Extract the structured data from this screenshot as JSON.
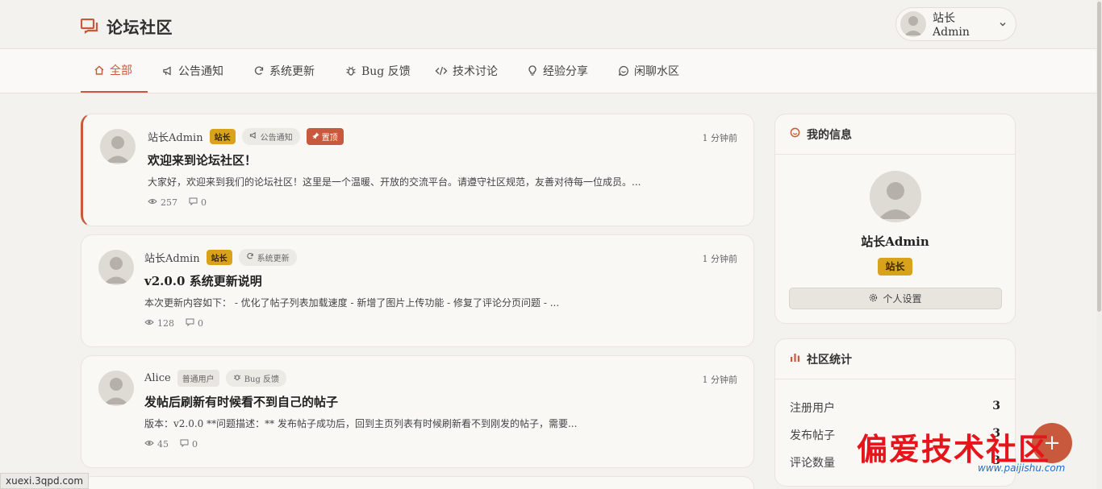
{
  "header": {
    "site_title": "论坛社区",
    "user_name": "站长Admin"
  },
  "nav": {
    "tabs": [
      {
        "label": "全部",
        "icon": "home-icon"
      },
      {
        "label": "公告通知",
        "icon": "megaphone-icon"
      },
      {
        "label": "系统更新",
        "icon": "refresh-icon"
      },
      {
        "label": "Bug 反馈",
        "icon": "bug-icon"
      },
      {
        "label": "技术讨论",
        "icon": "code-icon"
      },
      {
        "label": "经验分享",
        "icon": "lightbulb-icon"
      },
      {
        "label": "闲聊水区",
        "icon": "chat-icon"
      }
    ],
    "active": "全部"
  },
  "posts": [
    {
      "author": "站长Admin",
      "role": "站长",
      "category": "公告通知",
      "pin": "置顶",
      "time": "1 分钟前",
      "title": "欢迎来到论坛社区！",
      "excerpt": "大家好，欢迎来到我们的论坛社区！这里是一个温暖、开放的交流平台。请遵守社区规范，友善对待每一位成员。...",
      "views": "257",
      "comments": "0"
    },
    {
      "author": "站长Admin",
      "role": "站长",
      "category": "系统更新",
      "time": "1 分钟前",
      "title": "v2.0.0 系统更新说明",
      "excerpt": "本次更新内容如下： - 优化了帖子列表加载速度 - 新增了图片上传功能 - 修复了评论分页问题 - ...",
      "views": "128",
      "comments": "0"
    },
    {
      "author": "Alice",
      "role": "普通用户",
      "category": "Bug 反馈",
      "time": "1 分钟前",
      "title": "发帖后刷新有时候看不到自己的帖子",
      "excerpt": "版本：v2.0.0 **问题描述：** 发布帖子成功后，回到主页列表有时候刷新看不到刚发的帖子，需要...",
      "views": "45",
      "comments": "0"
    }
  ],
  "sidebar": {
    "my_info": {
      "title": "我的信息",
      "name": "站长Admin",
      "role": "站长",
      "settings_label": "个人设置"
    },
    "community_stats": {
      "title": "社区统计",
      "rows": [
        {
          "label": "注册用户",
          "value": "3"
        },
        {
          "label": "发布帖子",
          "value": "3"
        },
        {
          "label": "评论数量",
          "value": "3"
        }
      ]
    }
  },
  "fab_label": "+",
  "watermark": {
    "text": "偏爱技术社区",
    "url": "www.paijishu.com"
  },
  "status_url": "xuexi.3qpd.com",
  "colors": {
    "accent": "#c8593c",
    "owner_badge": "#d9a21b",
    "background": "#f4f2ee"
  }
}
